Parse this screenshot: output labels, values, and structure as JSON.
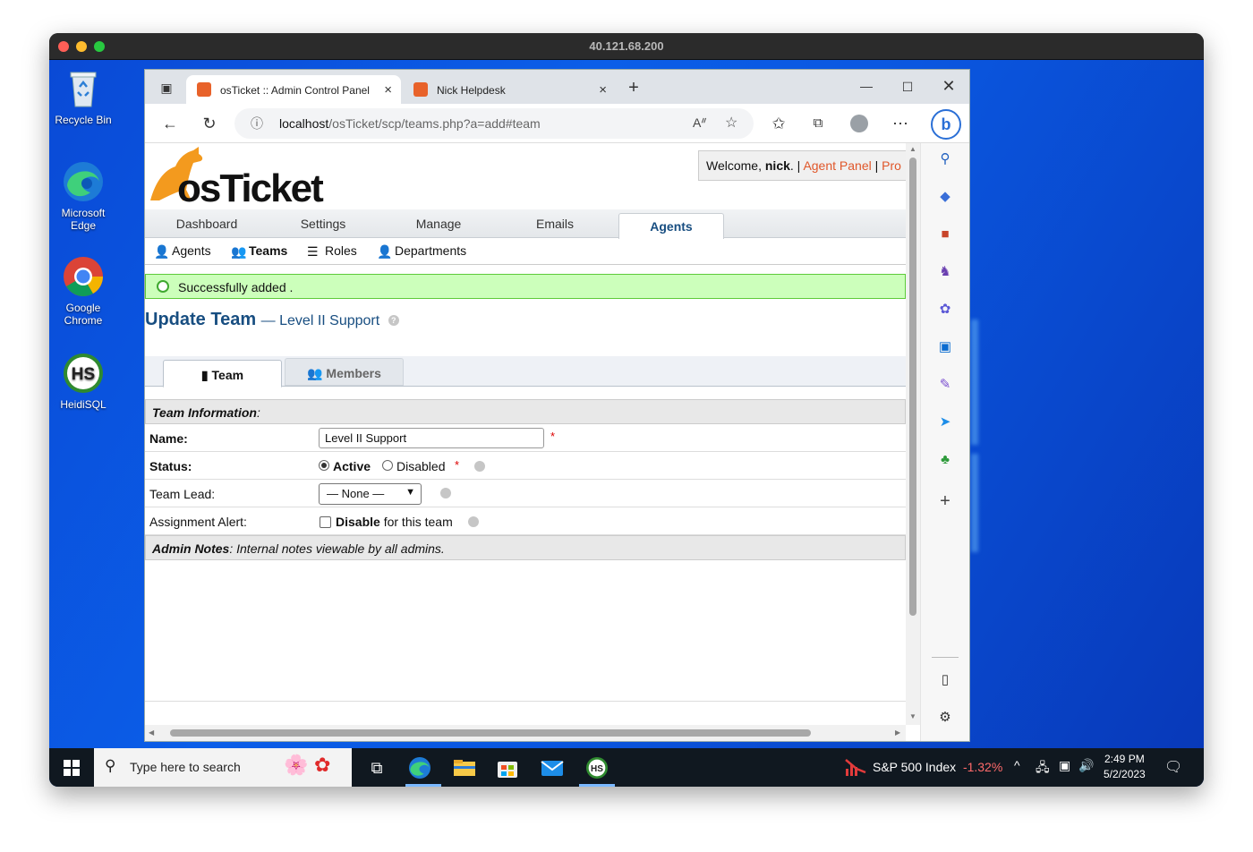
{
  "mac": {
    "title": "40.121.68.200"
  },
  "desktop": {
    "icons": [
      {
        "label": "Recycle Bin"
      },
      {
        "label": "Microsoft Edge"
      },
      {
        "label": "Google Chrome"
      },
      {
        "label": "HeidiSQL"
      }
    ]
  },
  "browser": {
    "tabs": [
      {
        "title": "osTicket :: Admin Control Panel",
        "close": "×"
      },
      {
        "title": "Nick Helpdesk",
        "close": "×"
      }
    ],
    "new_tab": "+",
    "url_host": "localhost",
    "url_path": "/osTicket/scp/teams.php?a=add#team"
  },
  "header": {
    "logo_text": "osTicket",
    "welcome_prefix": "Welcome, ",
    "welcome_user": "nick",
    "welcome_sep": ". | ",
    "agent_panel": "Agent Panel",
    "sep2": " | ",
    "profile": "Pro"
  },
  "nav": {
    "items": [
      "Dashboard",
      "Settings",
      "Manage",
      "Emails"
    ],
    "active": "Agents"
  },
  "subnav": {
    "agents": "Agents",
    "teams": "Teams",
    "roles": "Roles",
    "departments": "Departments"
  },
  "message": {
    "success": "Successfully added ."
  },
  "title": {
    "main": "Update Team",
    "sub": "— Level II Support",
    "help": "?"
  },
  "page_tabs": {
    "team": "Team",
    "members": "Members"
  },
  "form": {
    "section_info": "Team Information",
    "section_info_suffix": ":",
    "name_label": "Name:",
    "name_value": "Level II Support",
    "required": "*",
    "status_label": "Status:",
    "status_active": "Active",
    "status_disabled": "Disabled",
    "lead_label": "Team Lead:",
    "lead_value": "— None —",
    "alert_label": "Assignment Alert:",
    "alert_bold": "Disable",
    "alert_rest": " for this team",
    "notes_title": "Admin Notes",
    "notes_desc": ": Internal notes viewable by all admins."
  },
  "taskbar": {
    "search_placeholder": "Type here to search",
    "stock_name": "S&P 500 Index",
    "stock_change": "-1.32%",
    "time": "2:49 PM",
    "date": "5/2/2023"
  },
  "colors": {
    "brand_blue": "#184e81",
    "link_orange": "#e0572a",
    "success_bg": "#ccffbb",
    "desktop_blue": "#0b5ee8"
  }
}
